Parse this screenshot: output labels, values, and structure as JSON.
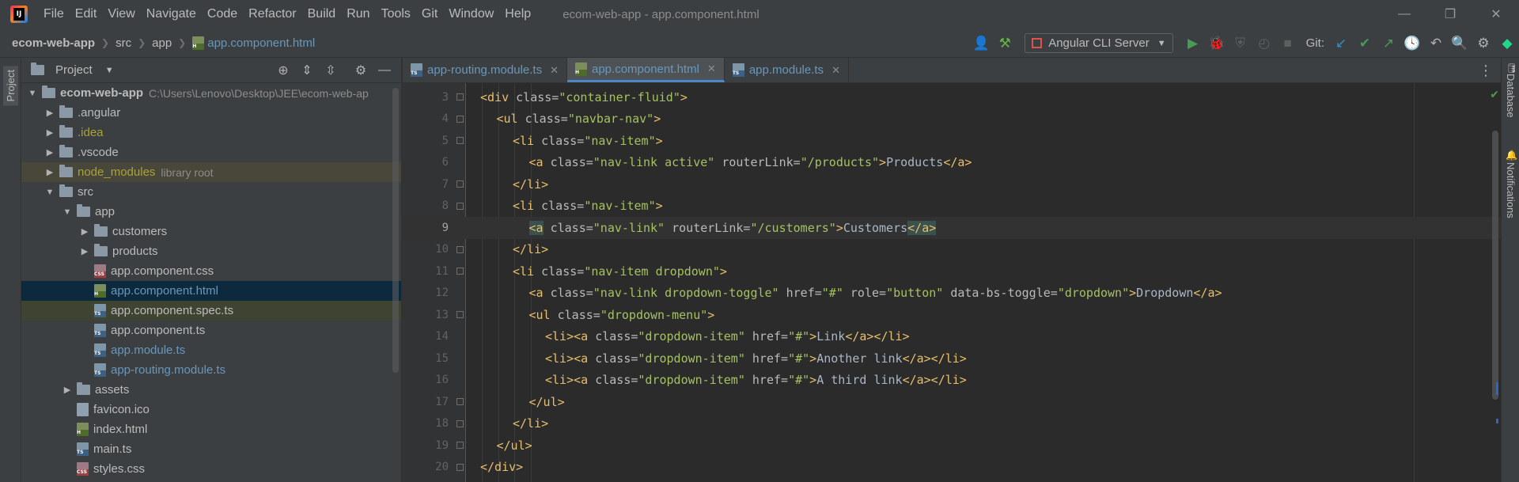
{
  "menu": [
    "File",
    "Edit",
    "View",
    "Navigate",
    "Code",
    "Refactor",
    "Build",
    "Run",
    "Tools",
    "Git",
    "Window",
    "Help"
  ],
  "window_title": "ecom-web-app - app.component.html",
  "window_controls": {
    "minimize": "—",
    "restore": "❐",
    "close": "✕"
  },
  "breadcrumbs": [
    "ecom-web-app",
    "src",
    "app",
    "app.component.html"
  ],
  "toolbar": {
    "run_config": "Angular CLI Server",
    "git_label": "Git:"
  },
  "left_strip": {
    "project_tab": "Project"
  },
  "project_panel": {
    "title": "Project",
    "tree": [
      {
        "label": "ecom-web-app",
        "path": "C:\\Users\\Lenovo\\Desktop\\JEE\\ecom-web-ap",
        "depth": 0,
        "kind": "folder",
        "expanded": true,
        "style": "bold"
      },
      {
        "label": ".angular",
        "depth": 1,
        "kind": "folder",
        "expanded": false,
        "style": "normal"
      },
      {
        "label": ".idea",
        "depth": 1,
        "kind": "folder",
        "expanded": false,
        "style": "yellow"
      },
      {
        "label": ".vscode",
        "depth": 1,
        "kind": "folder",
        "expanded": false,
        "style": "normal"
      },
      {
        "label": "node_modules",
        "path": "library root",
        "depth": 1,
        "kind": "folder",
        "expanded": false,
        "style": "yellow",
        "row": "lib"
      },
      {
        "label": "src",
        "depth": 1,
        "kind": "folder",
        "expanded": true,
        "style": "normal"
      },
      {
        "label": "app",
        "depth": 2,
        "kind": "folder",
        "expanded": true,
        "style": "normal"
      },
      {
        "label": "customers",
        "depth": 3,
        "kind": "folder",
        "expanded": false,
        "style": "normal"
      },
      {
        "label": "products",
        "depth": 3,
        "kind": "folder",
        "expanded": false,
        "style": "normal"
      },
      {
        "label": "app.component.css",
        "depth": 3,
        "kind": "css",
        "style": "normal"
      },
      {
        "label": "app.component.html",
        "depth": 3,
        "kind": "html",
        "style": "blue",
        "row": "selected"
      },
      {
        "label": "app.component.spec.ts",
        "depth": 3,
        "kind": "ts",
        "style": "normal",
        "row": "spec"
      },
      {
        "label": "app.component.ts",
        "depth": 3,
        "kind": "ts",
        "style": "normal"
      },
      {
        "label": "app.module.ts",
        "depth": 3,
        "kind": "ts",
        "style": "blue"
      },
      {
        "label": "app-routing.module.ts",
        "depth": 3,
        "kind": "ts",
        "style": "blue"
      },
      {
        "label": "assets",
        "depth": 2,
        "kind": "folder",
        "expanded": false,
        "style": "normal"
      },
      {
        "label": "favicon.ico",
        "depth": 2,
        "kind": "ico",
        "style": "normal"
      },
      {
        "label": "index.html",
        "depth": 2,
        "kind": "html",
        "style": "normal"
      },
      {
        "label": "main.ts",
        "depth": 2,
        "kind": "ts",
        "style": "normal"
      },
      {
        "label": "styles.css",
        "depth": 2,
        "kind": "css",
        "style": "normal"
      }
    ]
  },
  "editor": {
    "tabs": [
      {
        "label": "app-routing.module.ts",
        "kind": "ts",
        "active": false
      },
      {
        "label": "app.component.html",
        "kind": "html",
        "active": true
      },
      {
        "label": "app.module.ts",
        "kind": "ts",
        "active": false
      }
    ],
    "current_line": 9,
    "lines": [
      {
        "n": 3,
        "indent": 0,
        "fold": true,
        "tokens": [
          [
            "tg",
            "<div "
          ],
          [
            "at",
            "class="
          ],
          [
            "vl",
            "\"container-fluid\""
          ],
          [
            "tg",
            ">"
          ]
        ]
      },
      {
        "n": 4,
        "indent": 1,
        "fold": true,
        "tokens": [
          [
            "tg",
            "<ul "
          ],
          [
            "at",
            "class="
          ],
          [
            "vl",
            "\"navbar-nav\""
          ],
          [
            "tg",
            ">"
          ]
        ]
      },
      {
        "n": 5,
        "indent": 2,
        "fold": true,
        "tokens": [
          [
            "tg",
            "<li "
          ],
          [
            "at",
            "class="
          ],
          [
            "vl",
            "\"nav-item\""
          ],
          [
            "tg",
            ">"
          ]
        ]
      },
      {
        "n": 6,
        "indent": 3,
        "fold": false,
        "tokens": [
          [
            "tg",
            "<a "
          ],
          [
            "at",
            "class="
          ],
          [
            "vl",
            "\"nav-link active\" "
          ],
          [
            "at",
            "routerLink="
          ],
          [
            "vl",
            "\"/products\""
          ],
          [
            "tg",
            ">"
          ],
          [
            "tx",
            "Products"
          ],
          [
            "tg",
            "</a>"
          ]
        ]
      },
      {
        "n": 7,
        "indent": 2,
        "fold": true,
        "tokens": [
          [
            "tg",
            "</li>"
          ]
        ]
      },
      {
        "n": 8,
        "indent": 2,
        "fold": true,
        "tokens": [
          [
            "tg",
            "<li "
          ],
          [
            "at",
            "class="
          ],
          [
            "vl",
            "\"nav-item\""
          ],
          [
            "tg",
            ">"
          ]
        ]
      },
      {
        "n": 9,
        "indent": 3,
        "fold": false,
        "tokens": [
          [
            "tgm",
            "<a"
          ],
          [
            "tg",
            " "
          ],
          [
            "at",
            "class="
          ],
          [
            "vl",
            "\"nav-link\" "
          ],
          [
            "at",
            "routerLink="
          ],
          [
            "vl",
            "\"/customers\""
          ],
          [
            "tg",
            ">"
          ],
          [
            "tx",
            "Customers"
          ],
          [
            "tgm",
            "</a>"
          ]
        ]
      },
      {
        "n": 10,
        "indent": 2,
        "fold": true,
        "tokens": [
          [
            "tg",
            "</li>"
          ]
        ]
      },
      {
        "n": 11,
        "indent": 2,
        "fold": true,
        "tokens": [
          [
            "tg",
            "<li "
          ],
          [
            "at",
            "class="
          ],
          [
            "vl",
            "\"nav-item dropdown\""
          ],
          [
            "tg",
            ">"
          ]
        ]
      },
      {
        "n": 12,
        "indent": 3,
        "fold": false,
        "tokens": [
          [
            "tg",
            "<a "
          ],
          [
            "at",
            "class="
          ],
          [
            "vl",
            "\"nav-link dropdown-toggle\" "
          ],
          [
            "at",
            "href="
          ],
          [
            "vl",
            "\"#\" "
          ],
          [
            "at",
            "role="
          ],
          [
            "vl",
            "\"button\" "
          ],
          [
            "at",
            "data-bs-toggle="
          ],
          [
            "vl",
            "\"dropdown\""
          ],
          [
            "tg",
            ">"
          ],
          [
            "tx",
            "Dropdown"
          ],
          [
            "tg",
            "</a>"
          ]
        ]
      },
      {
        "n": 13,
        "indent": 3,
        "fold": true,
        "tokens": [
          [
            "tg",
            "<ul "
          ],
          [
            "at",
            "class="
          ],
          [
            "vl",
            "\"dropdown-menu\""
          ],
          [
            "tg",
            ">"
          ]
        ]
      },
      {
        "n": 14,
        "indent": 4,
        "fold": false,
        "tokens": [
          [
            "tg",
            "<li><a "
          ],
          [
            "at",
            "class="
          ],
          [
            "vl",
            "\"dropdown-item\" "
          ],
          [
            "at",
            "href="
          ],
          [
            "vl",
            "\"#\""
          ],
          [
            "tg",
            ">"
          ],
          [
            "tx",
            "Link"
          ],
          [
            "tg",
            "</a></li>"
          ]
        ]
      },
      {
        "n": 15,
        "indent": 4,
        "fold": false,
        "tokens": [
          [
            "tg",
            "<li><a "
          ],
          [
            "at",
            "class="
          ],
          [
            "vl",
            "\"dropdown-item\" "
          ],
          [
            "at",
            "href="
          ],
          [
            "vl",
            "\"#\""
          ],
          [
            "tg",
            ">"
          ],
          [
            "tx",
            "Another link"
          ],
          [
            "tg",
            "</a></li>"
          ]
        ]
      },
      {
        "n": 16,
        "indent": 4,
        "fold": false,
        "tokens": [
          [
            "tg",
            "<li><a "
          ],
          [
            "at",
            "class="
          ],
          [
            "vl",
            "\"dropdown-item\" "
          ],
          [
            "at",
            "href="
          ],
          [
            "vl",
            "\"#\""
          ],
          [
            "tg",
            ">"
          ],
          [
            "tx",
            "A third link"
          ],
          [
            "tg",
            "</a></li>"
          ]
        ]
      },
      {
        "n": 17,
        "indent": 3,
        "fold": true,
        "tokens": [
          [
            "tg",
            "</ul>"
          ]
        ]
      },
      {
        "n": 18,
        "indent": 2,
        "fold": true,
        "tokens": [
          [
            "tg",
            "</li>"
          ]
        ]
      },
      {
        "n": 19,
        "indent": 1,
        "fold": true,
        "tokens": [
          [
            "tg",
            "</ul>"
          ]
        ]
      },
      {
        "n": 20,
        "indent": 0,
        "fold": true,
        "tokens": [
          [
            "tg",
            "</div>"
          ]
        ]
      }
    ]
  },
  "right_strip": {
    "database_tab": "Database",
    "notifications_tab": "Notifications"
  },
  "colors": {
    "selection": "#0d293e",
    "accent": "#4a88c7",
    "tag": "#e8bf6a",
    "value": "#a5c261",
    "attr": "#bababa"
  }
}
